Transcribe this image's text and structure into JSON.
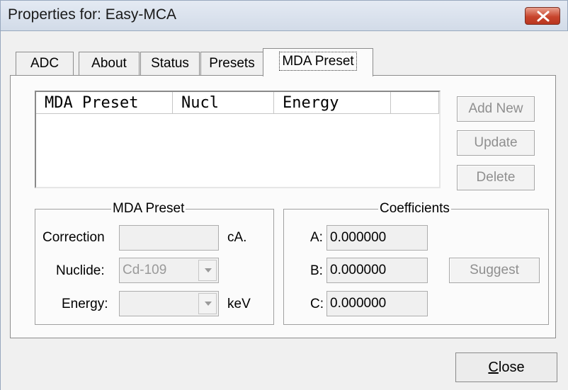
{
  "window": {
    "title": "Properties for: Easy-MCA",
    "close_icon": "close-x-icon",
    "accent": "#c8452d"
  },
  "tabs": [
    {
      "label": "ADC"
    },
    {
      "label": "About"
    },
    {
      "label": "Status"
    },
    {
      "label": "Presets"
    },
    {
      "label": "MDA Preset",
      "active": true
    }
  ],
  "list": {
    "columns": [
      "MDA Preset",
      "Nucl",
      "Energy",
      ""
    ],
    "rows": []
  },
  "side_buttons": {
    "add_new": "Add New",
    "update": "Update",
    "delete": "Delete"
  },
  "mda_group": {
    "title": "MDA Preset",
    "correction_label": "Correction",
    "correction_value": "",
    "correction_unit": "cA.",
    "nuclide_label": "Nuclide:",
    "nuclide_value": "Cd-109",
    "energy_label": "Energy:",
    "energy_value": "",
    "energy_unit": "keV"
  },
  "coeff_group": {
    "title": "Coefficients",
    "a_label": "A:",
    "a_value": "0.000000",
    "b_label": "B:",
    "b_value": "0.000000",
    "c_label": "C:",
    "c_value": "0.000000",
    "suggest": "Suggest"
  },
  "footer": {
    "close_mnemonic": "C",
    "close_rest": "lose"
  }
}
